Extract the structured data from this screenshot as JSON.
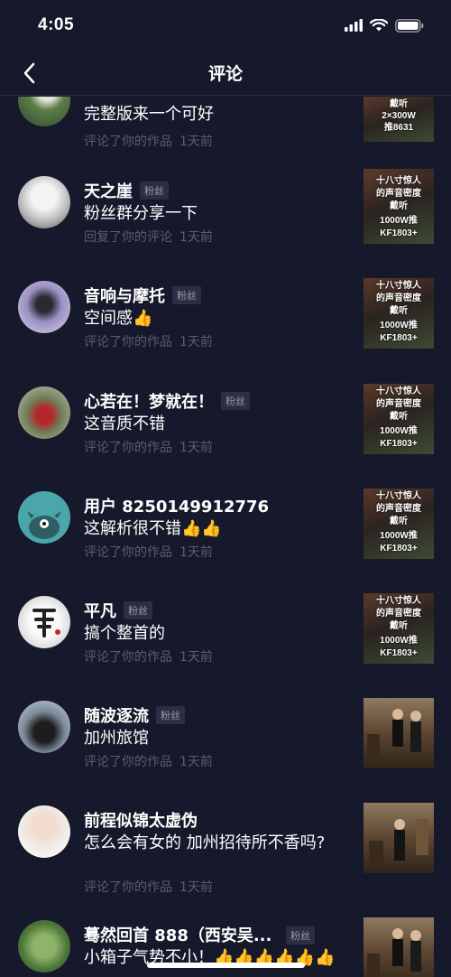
{
  "status_bar": {
    "time": "4:05"
  },
  "header": {
    "title": "评论",
    "back_icon": "chevron-left-icon"
  },
  "badge_label": "粉丝",
  "thumb_video_text": [
    "十八寸惊人",
    "的声音密度",
    "戴听",
    "1000W推",
    "KF1803+"
  ],
  "thumb_video_text_first": [
    "戴听",
    "2×300W",
    "推8631"
  ],
  "items": [
    {
      "name": "",
      "badge": false,
      "comment": "完整版来一个可好",
      "action": "评论了你的作品",
      "time": "1天前",
      "thumb": "video-first"
    },
    {
      "name": "天之崖",
      "badge": true,
      "comment": "粉丝群分享一下",
      "action": "回复了你的评论",
      "time": "1天前",
      "thumb": "video"
    },
    {
      "name": "音响与摩托",
      "badge": true,
      "comment": "空间感👍",
      "action": "评论了你的作品",
      "time": "1天前",
      "thumb": "video"
    },
    {
      "name": "心若在！梦就在！",
      "badge": true,
      "comment": "这音质不错",
      "action": "评论了你的作品",
      "time": "1天前",
      "thumb": "video"
    },
    {
      "name": "用户 8250149912776",
      "badge": false,
      "comment": "这解析很不错👍👍",
      "action": "评论了你的作品",
      "time": "1天前",
      "thumb": "video"
    },
    {
      "name": "平凡",
      "badge": true,
      "comment": "搞个整首的",
      "action": "评论了你的作品",
      "time": "1天前",
      "thumb": "video"
    },
    {
      "name": "随波逐流",
      "badge": true,
      "comment": "加州旅馆",
      "action": "评论了你的作品",
      "time": "1天前",
      "thumb": "photo"
    },
    {
      "name": "前程似锦太虚伪",
      "badge": false,
      "comment": "怎么会有女的 加州招待所不香吗?",
      "action": "评论了你的作品",
      "time": "1天前",
      "thumb": "photo"
    },
    {
      "name": "蓦然回首 888（西安吴...",
      "badge": true,
      "comment": "小箱子气势不小！👍👍👍👍👍👍",
      "action": "",
      "time": "",
      "thumb": "photo"
    }
  ]
}
